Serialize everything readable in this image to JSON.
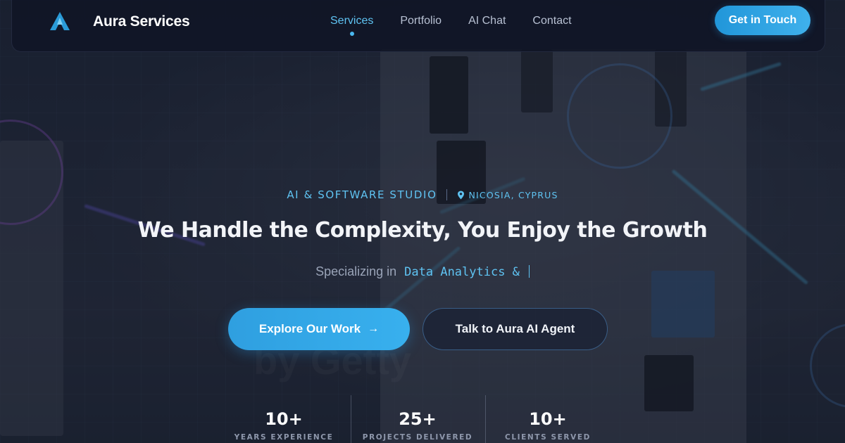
{
  "nav": {
    "brand": "Aura Services",
    "links": [
      {
        "label": "Services",
        "active": true
      },
      {
        "label": "Portfolio",
        "active": false
      },
      {
        "label": "AI Chat",
        "active": false
      },
      {
        "label": "Contact",
        "active": false
      }
    ],
    "cta_label": "Get in Touch"
  },
  "hero": {
    "eyebrow": "AI & SOFTWARE STUDIO",
    "location": "NICOSIA, CYPRUS",
    "headline": "We Handle the Complexity, You Enjoy the Growth",
    "sub_prefix": "Specializing in",
    "sub_typed": "Data Analytics &",
    "primary_button": "Explore Our Work",
    "secondary_button": "Talk to Aura AI Agent"
  },
  "stats": [
    {
      "value": "10+",
      "label": "YEARS EXPERIENCE"
    },
    {
      "value": "25+",
      "label": "PROJECTS DELIVERED"
    },
    {
      "value": "10+",
      "label": "CLIENTS SERVED"
    }
  ],
  "icons": {
    "logo": "aura-logo-icon",
    "location": "map-pin-icon",
    "arrow": "arrow-right-icon"
  },
  "colors": {
    "accent": "#3fb1ec",
    "accent_text": "#5fc3f2",
    "nav_bg": "#10152a"
  }
}
